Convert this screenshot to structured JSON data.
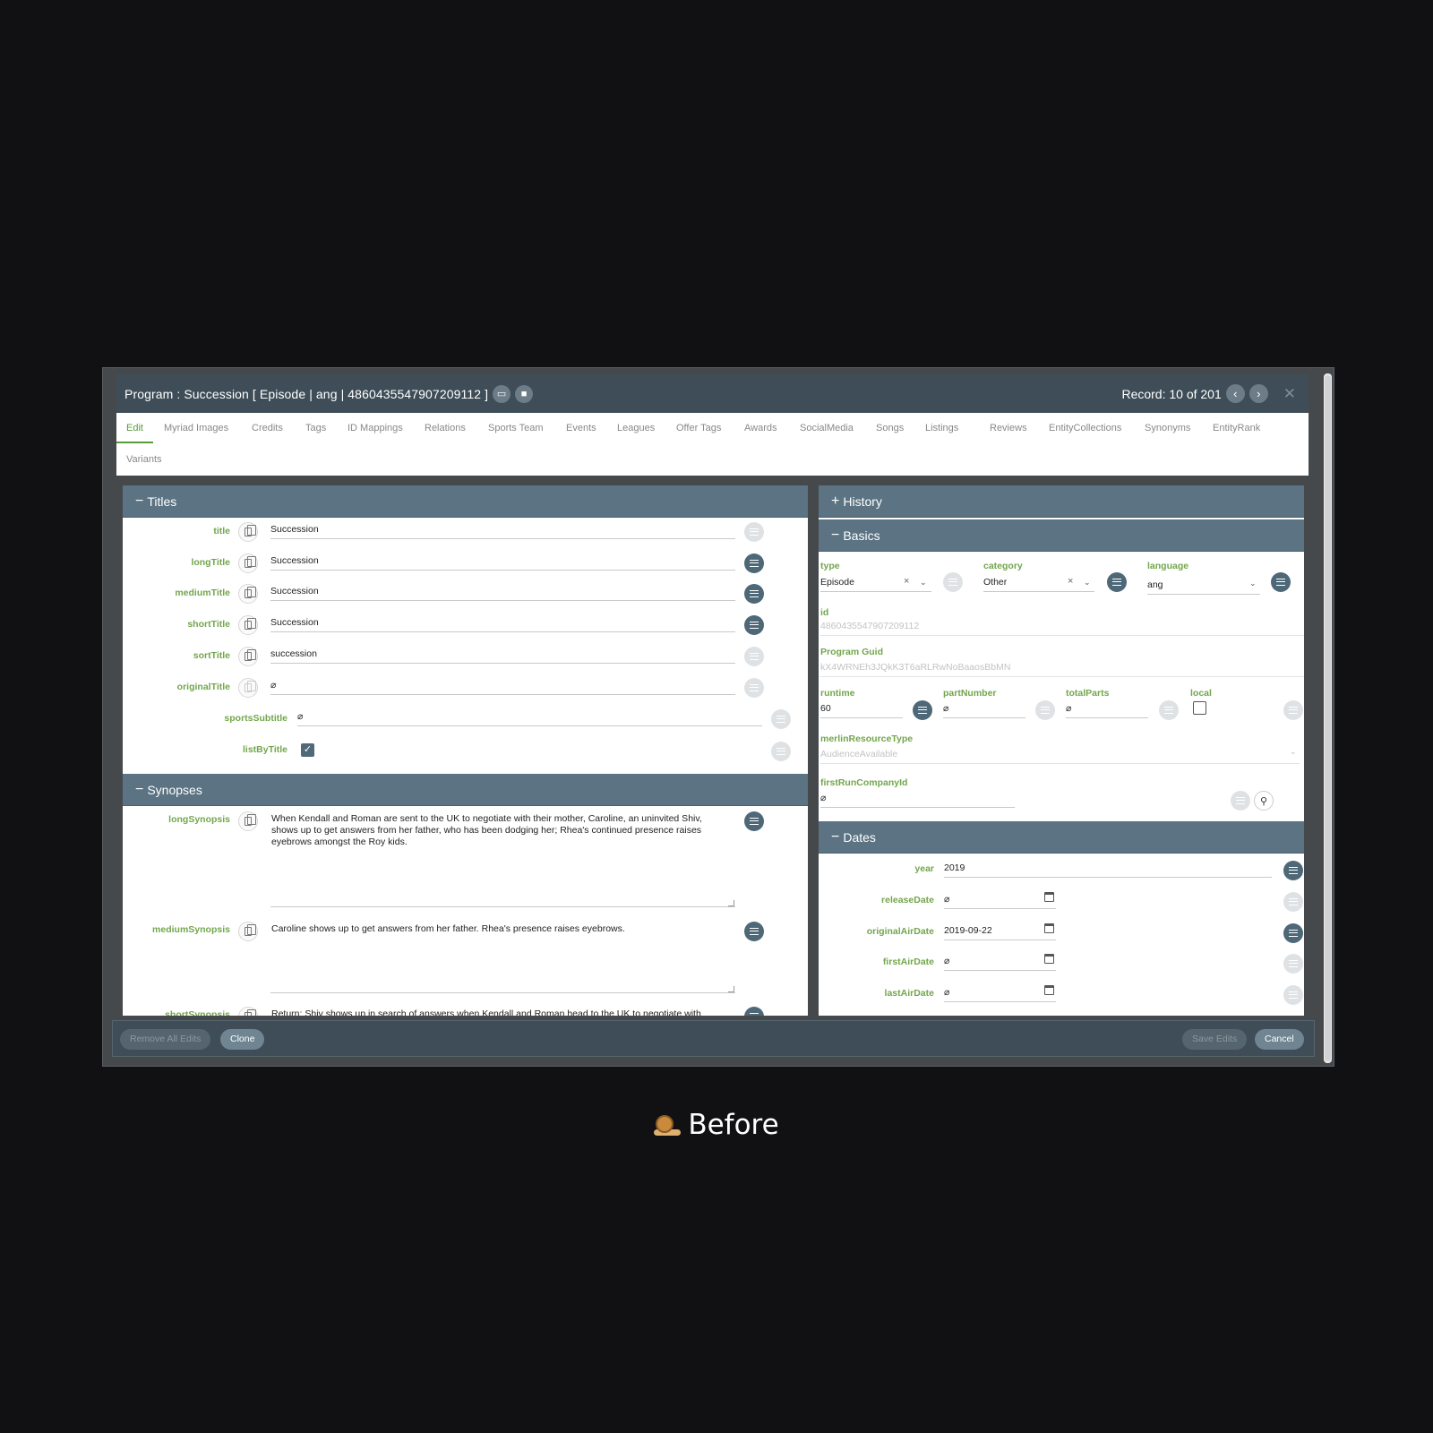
{
  "window": {
    "title": "Program : Succession [ Episode | ang | 4860435547907209112 ]",
    "record": "Record: 10 of 201"
  },
  "tabs": [
    "Edit",
    "Myriad Images",
    "Credits",
    "Tags",
    "ID Mappings",
    "Relations",
    "Sports Team",
    "Events",
    "Leagues",
    "Offer Tags",
    "Awards",
    "SocialMedia",
    "Songs",
    "Listings",
    "Reviews",
    "EntityCollections",
    "Synonyms",
    "EntityRank",
    "Variants"
  ],
  "titles": {
    "header": "Titles",
    "fields": {
      "title": {
        "label": "title",
        "value": "Succession"
      },
      "longTitle": {
        "label": "longTitle",
        "value": "Succession"
      },
      "mediumTitle": {
        "label": "mediumTitle",
        "value": "Succession"
      },
      "shortTitle": {
        "label": "shortTitle",
        "value": "Succession"
      },
      "sortTitle": {
        "label": "sortTitle",
        "value": "succession"
      },
      "originalTitle": {
        "label": "originalTitle",
        "value": "⌀"
      },
      "sportsSubtitle": {
        "label": "sportsSubtitle",
        "value": "⌀"
      },
      "listByTitle": {
        "label": "listByTitle",
        "checked": true
      }
    }
  },
  "synopses": {
    "header": "Synopses",
    "long": {
      "label": "longSynopsis",
      "value": "When Kendall and Roman are sent to the UK to negotiate with their mother, Caroline, an uninvited Shiv, shows up to get answers from her father, who has been dodging her; Rhea's continued presence raises eyebrows amongst the Roy kids."
    },
    "medium": {
      "label": "mediumSynopsis",
      "value": "Caroline shows up to get answers from her father. Rhea's presence raises eyebrows."
    },
    "short": {
      "label": "shortSynopsis",
      "value": "Return: Shiv shows up in search of answers when Kendall and Roman head to the UK to negotiate with"
    }
  },
  "history": {
    "header": "History"
  },
  "basics": {
    "header": "Basics",
    "type": {
      "label": "type",
      "value": "Episode"
    },
    "category": {
      "label": "category",
      "value": "Other"
    },
    "language": {
      "label": "language",
      "value": "ang"
    },
    "id": {
      "label": "id",
      "value": "4860435547907209112"
    },
    "programGuid": {
      "label": "Program Guid",
      "value": "kX4WRNEh3JQkK3T6aRLRwNoBaaosBbMN"
    },
    "runtime": {
      "label": "runtime",
      "value": "60"
    },
    "partNumber": {
      "label": "partNumber",
      "value": "⌀"
    },
    "totalParts": {
      "label": "totalParts",
      "value": "⌀"
    },
    "local": {
      "label": "local",
      "checked": false
    },
    "merlinResourceType": {
      "label": "merlinResourceType",
      "value": "AudienceAvailable"
    },
    "firstRunCompanyId": {
      "label": "firstRunCompanyId",
      "value": "⌀"
    }
  },
  "dates": {
    "header": "Dates",
    "year": {
      "label": "year",
      "value": "2019"
    },
    "releaseDate": {
      "label": "releaseDate",
      "value": "⌀"
    },
    "originalAirDate": {
      "label": "originalAirDate",
      "value": "2019-09-22"
    },
    "firstAirDate": {
      "label": "firstAirDate",
      "value": "⌀"
    },
    "lastAirDate": {
      "label": "lastAirDate",
      "value": "⌀"
    }
  },
  "footer": {
    "remove_all_edits": "Remove All Edits",
    "clone": "Clone",
    "save_edits": "Save Edits",
    "cancel": "Cancel"
  },
  "caption": "Before",
  "colors": {
    "accent_green": "#72a64c",
    "header_slate": "#5b7383",
    "titlebar": "#3e4d57"
  }
}
